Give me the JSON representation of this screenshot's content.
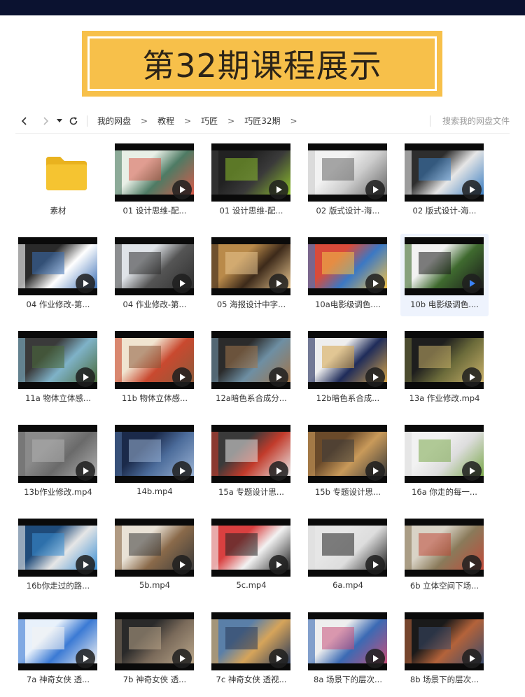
{
  "banner": {
    "title": "第32期课程展示"
  },
  "nav": {
    "breadcrumbs": [
      "我的网盘",
      "教程",
      "巧匠",
      "巧匠32期"
    ],
    "crumb_separator": ">",
    "search_placeholder": "搜索我的网盘文件",
    "back_icon": "chevron-left-icon",
    "forward_icon": "chevron-right-icon",
    "dropdown_icon": "caret-down-icon",
    "refresh_icon": "refresh-icon"
  },
  "colors": {
    "topbar": "#0b1230",
    "banner": "#f7c04a",
    "folder": "#f5c431",
    "selected_bg": "#eef3fd"
  },
  "files": [
    {
      "name": "素材",
      "type": "folder"
    },
    {
      "name": "01 设计思维-配...",
      "type": "video",
      "palette": [
        "#e8efe6",
        "#4e7b64",
        "#d85a4a"
      ]
    },
    {
      "name": "01 设计思维-配...",
      "type": "video",
      "palette": [
        "#222222",
        "#3a3a3a",
        "#8dbf2b"
      ]
    },
    {
      "name": "02 版式设计-海...",
      "type": "video",
      "palette": [
        "#f2f2f2",
        "#cccccc",
        "#666666"
      ]
    },
    {
      "name": "02 版式设计-海...",
      "type": "video",
      "palette": [
        "#2e2e2e",
        "#e6e6e6",
        "#3a7dc1"
      ]
    },
    {
      "name": "04 作业修改-第...",
      "type": "video",
      "palette": [
        "#2a2a2a",
        "#ffffff",
        "#3b6fb5"
      ]
    },
    {
      "name": "04 作业修改-第...",
      "type": "video",
      "palette": [
        "#dfe3e8",
        "#555555",
        "#2f2f2f"
      ]
    },
    {
      "name": "05 海报设计中字...",
      "type": "video",
      "palette": [
        "#b98a4a",
        "#3d2a1a",
        "#e7c58f"
      ]
    },
    {
      "name": "10a电影级调色....",
      "type": "video",
      "palette": [
        "#d94b3a",
        "#3b78c4",
        "#f1c24a"
      ]
    },
    {
      "name": "10b 电影级调色....",
      "type": "video",
      "selected": true,
      "palette": [
        "#f2f2f2",
        "#3f6a2f",
        "#1a1a1a"
      ]
    },
    {
      "name": "11a 物体立体感...",
      "type": "video",
      "palette": [
        "#3a3a3a",
        "#7fb2c8",
        "#4a6b3a"
      ]
    },
    {
      "name": "11b 物体立体感...",
      "type": "video",
      "palette": [
        "#f0e4d0",
        "#c9492f",
        "#8c5a3a"
      ]
    },
    {
      "name": "12a暗色系合成分...",
      "type": "video",
      "palette": [
        "#2b2b2b",
        "#6e8fa3",
        "#a0744a"
      ]
    },
    {
      "name": "12b暗色系合成...",
      "type": "video",
      "palette": [
        "#eeeeee",
        "#1f2c5a",
        "#d7a64a"
      ]
    },
    {
      "name": "13a 作业修改.mp4",
      "type": "video",
      "palette": [
        "#1e1e1e",
        "#6b6b3a",
        "#c9b06a"
      ]
    },
    {
      "name": "13b作业修改.mp4",
      "type": "video",
      "palette": [
        "#8a8a8a",
        "#6a6a6a",
        "#b0b0b0"
      ]
    },
    {
      "name": "14b.mp4",
      "type": "video",
      "palette": [
        "#1b2a4a",
        "#4b6b9a",
        "#9bb3d4"
      ]
    },
    {
      "name": "15a 专题设计思...",
      "type": "video",
      "palette": [
        "#3a3a3a",
        "#c23b2b",
        "#e8e8e8"
      ]
    },
    {
      "name": "15b 专题设计思...",
      "type": "video",
      "palette": [
        "#6a4a2a",
        "#c99a5a",
        "#3a3a3a"
      ]
    },
    {
      "name": "16a 你走的每一...",
      "type": "video",
      "palette": [
        "#f2f2f2",
        "#dddddd",
        "#7aa84a"
      ]
    },
    {
      "name": "16b你走过的路...",
      "type": "video",
      "palette": [
        "#1f4b7a",
        "#e6e6e6",
        "#3b8fd4"
      ]
    },
    {
      "name": "5b.mp4",
      "type": "video",
      "palette": [
        "#e9e2d6",
        "#8a6a4a",
        "#3a3a3a"
      ]
    },
    {
      "name": "5c.mp4",
      "type": "video",
      "palette": [
        "#d94040",
        "#f2f2f2",
        "#222222"
      ]
    },
    {
      "name": "6a.mp4",
      "type": "video",
      "palette": [
        "#e6e6e6",
        "#dddddd",
        "#222222"
      ]
    },
    {
      "name": "6b 立体空间下场...",
      "type": "video",
      "palette": [
        "#d9d3c6",
        "#8a7a5a",
        "#c04a3a"
      ]
    },
    {
      "name": "7a 神奇女侠 透...",
      "type": "video",
      "palette": [
        "#e8f1fb",
        "#3b7ad4",
        "#f2f2f2"
      ]
    },
    {
      "name": "7b 神奇女侠 透...",
      "type": "video",
      "palette": [
        "#2a2a2a",
        "#7a6a5a",
        "#b9a68a"
      ]
    },
    {
      "name": "7c 神奇女侠 透视...",
      "type": "video",
      "palette": [
        "#5a7fa8",
        "#d6a45a",
        "#2a3a5a"
      ]
    },
    {
      "name": "8a 场景下的层次...",
      "type": "video",
      "palette": [
        "#eeeeee",
        "#3b6ab4",
        "#c9507a"
      ]
    },
    {
      "name": "8b 场景下的层次...",
      "type": "video",
      "palette": [
        "#1a1a1a",
        "#b4633a",
        "#3a4a6a"
      ]
    }
  ]
}
